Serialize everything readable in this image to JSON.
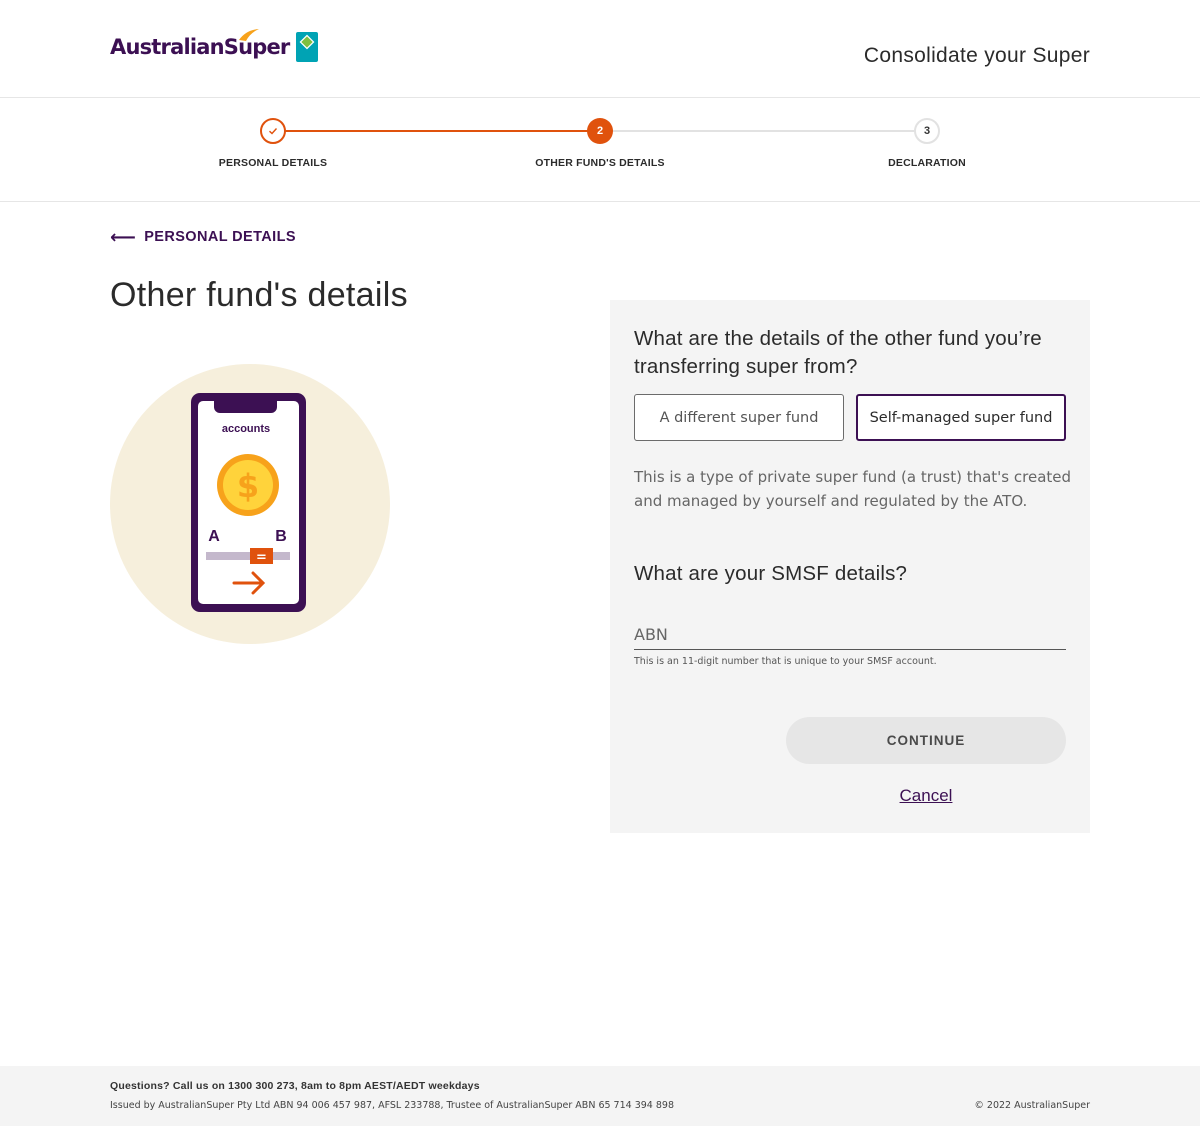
{
  "header": {
    "logo_text": "AustralianSuper",
    "title": "Consolidate your Super"
  },
  "stepper": {
    "steps": [
      {
        "number": "✓",
        "label": "PERSONAL DETAILS",
        "status": "complete"
      },
      {
        "number": "2",
        "label": "OTHER FUND'S DETAILS",
        "status": "current"
      },
      {
        "number": "3",
        "label": "DECLARATION",
        "status": "upcoming"
      }
    ]
  },
  "back_link": {
    "label": "PERSONAL DETAILS"
  },
  "page_title": "Other fund's details",
  "illustration": {
    "screen_text": "accounts",
    "label_a": "A",
    "label_b": "B",
    "equals": "="
  },
  "form": {
    "question1": "What are the details of the other fund you’re transferring super from?",
    "options": [
      {
        "label": "A different super fund",
        "selected": false
      },
      {
        "label": "Self-managed super fund",
        "selected": true
      }
    ],
    "description": "This is a type of private super fund (a trust) that's created and managed by yourself and regulated by the ATO.",
    "question2": "What are your SMSF details?",
    "abn_placeholder": "ABN",
    "abn_value": "",
    "abn_hint": "This is an 11-digit number that is unique to your SMSF account.",
    "continue_label": "CONTINUE",
    "cancel_label": "Cancel"
  },
  "footer": {
    "questions": "Questions? Call us on 1300 300 273, 8am to 8pm AEST/AEDT weekdays",
    "issued": "Issued by AustralianSuper Pty Ltd ABN 94 006 457 987, AFSL 233788, Trustee of AustralianSuper ABN 65 714 394 898",
    "copyright": "© 2022 AustralianSuper"
  },
  "colors": {
    "brand_purple": "#3c1053",
    "accent_orange": "#e0520d",
    "panel_bg": "#f4f4f4"
  }
}
